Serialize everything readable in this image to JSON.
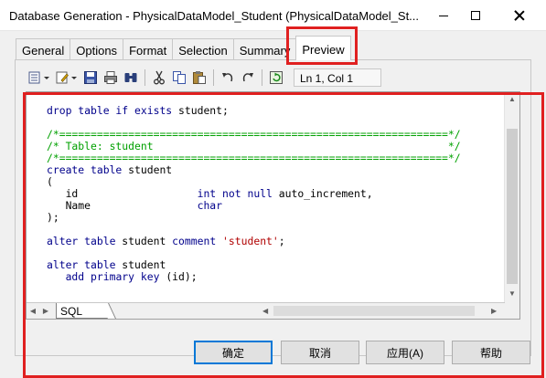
{
  "window": {
    "title": "Database Generation - PhysicalDataModel_Student (PhysicalDataModel_St..."
  },
  "tabs": [
    {
      "label": "General",
      "active": false
    },
    {
      "label": "Options",
      "active": false
    },
    {
      "label": "Format",
      "active": false
    },
    {
      "label": "Selection",
      "active": false
    },
    {
      "label": "Summary",
      "active": false
    },
    {
      "label": "Preview",
      "active": true
    }
  ],
  "toolbar": {
    "icons": [
      "properties-dropdown-icon",
      "edit-dropdown-icon",
      "save-icon",
      "print-icon",
      "find-icon",
      "cut-icon",
      "copy-icon",
      "paste-icon",
      "undo-icon",
      "redo-icon",
      "refresh-icon"
    ],
    "position": "Ln 1, Col 1"
  },
  "editor": {
    "lines": [
      [
        {
          "t": "drop table if exists ",
          "c": "kw"
        },
        {
          "t": "student;",
          "c": ""
        }
      ],
      [
        {
          "t": "",
          "c": ""
        }
      ],
      [
        {
          "t": "/*==============================================================*/",
          "c": "cm"
        }
      ],
      [
        {
          "t": "/* Table: student                                               */",
          "c": "cm"
        }
      ],
      [
        {
          "t": "/*==============================================================*/",
          "c": "cm"
        }
      ],
      [
        {
          "t": "create table ",
          "c": "kw"
        },
        {
          "t": "student",
          "c": ""
        }
      ],
      [
        {
          "t": "(",
          "c": ""
        }
      ],
      [
        {
          "t": "   id                   ",
          "c": ""
        },
        {
          "t": "int not null ",
          "c": "kw"
        },
        {
          "t": "auto_increment,",
          "c": ""
        }
      ],
      [
        {
          "t": "   Name                 ",
          "c": ""
        },
        {
          "t": "char",
          "c": "kw"
        }
      ],
      [
        {
          "t": ");",
          "c": ""
        }
      ],
      [
        {
          "t": "",
          "c": ""
        }
      ],
      [
        {
          "t": "alter table ",
          "c": "kw"
        },
        {
          "t": "student ",
          "c": ""
        },
        {
          "t": "comment ",
          "c": "kw"
        },
        {
          "t": "'student'",
          "c": "st"
        },
        {
          "t": ";",
          "c": ""
        }
      ],
      [
        {
          "t": "",
          "c": ""
        }
      ],
      [
        {
          "t": "alter table ",
          "c": "kw"
        },
        {
          "t": "student",
          "c": ""
        }
      ],
      [
        {
          "t": "   ",
          "c": ""
        },
        {
          "t": "add primary key ",
          "c": "kw"
        },
        {
          "t": "(id);",
          "c": ""
        }
      ]
    ],
    "sheet_tab": "SQL"
  },
  "buttons": {
    "ok": "确定",
    "cancel": "取消",
    "apply": "应用(A)",
    "help": "帮助"
  },
  "colors": {
    "keyword": "#00008b",
    "comment": "#00a000",
    "string": "#b00000",
    "annotation": "#e02020",
    "focus": "#0078d7"
  }
}
